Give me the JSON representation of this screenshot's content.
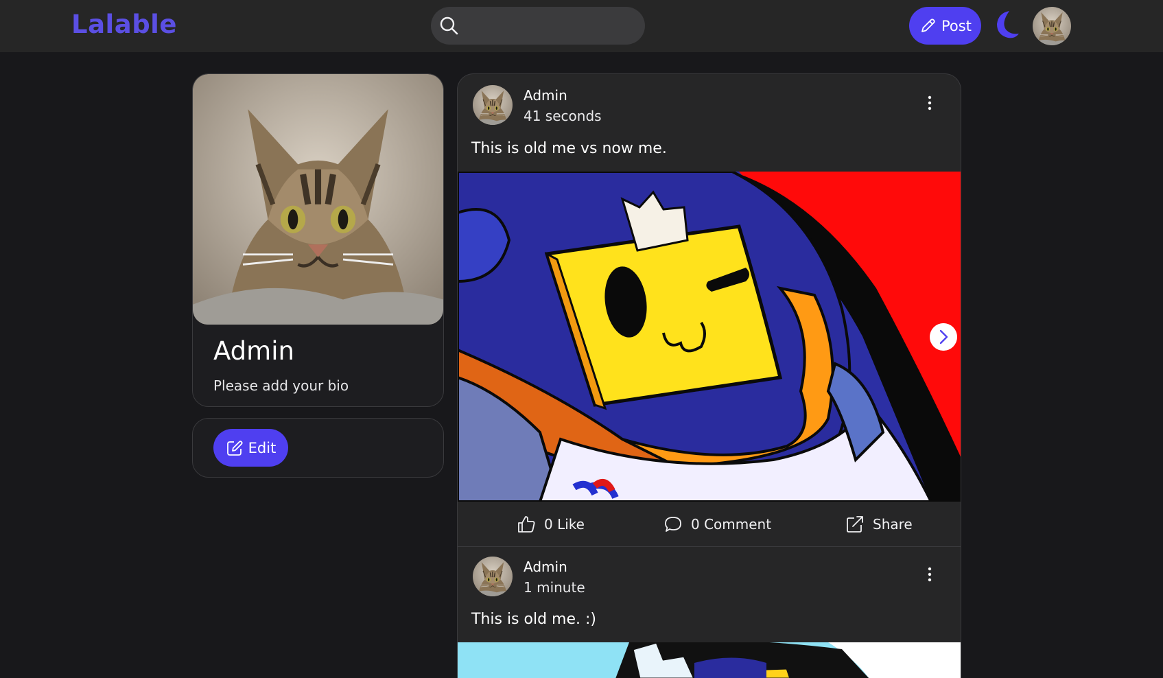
{
  "header": {
    "logo": "Lalable",
    "search_placeholder": "",
    "post_label": "Post",
    "theme_icon": "moon-icon",
    "accent_color": "#4f3ff0"
  },
  "profile": {
    "name": "Admin",
    "bio": "Please add your bio",
    "edit_label": "Edit"
  },
  "posts": [
    {
      "author": "Admin",
      "time": "41 seconds",
      "text": "This is old me vs now me.",
      "likes_label": "0 Like",
      "comments_label": "0 Comment",
      "share_label": "Share"
    },
    {
      "author": "Admin",
      "time": "1 minute",
      "text": "This is old me. :)"
    }
  ]
}
